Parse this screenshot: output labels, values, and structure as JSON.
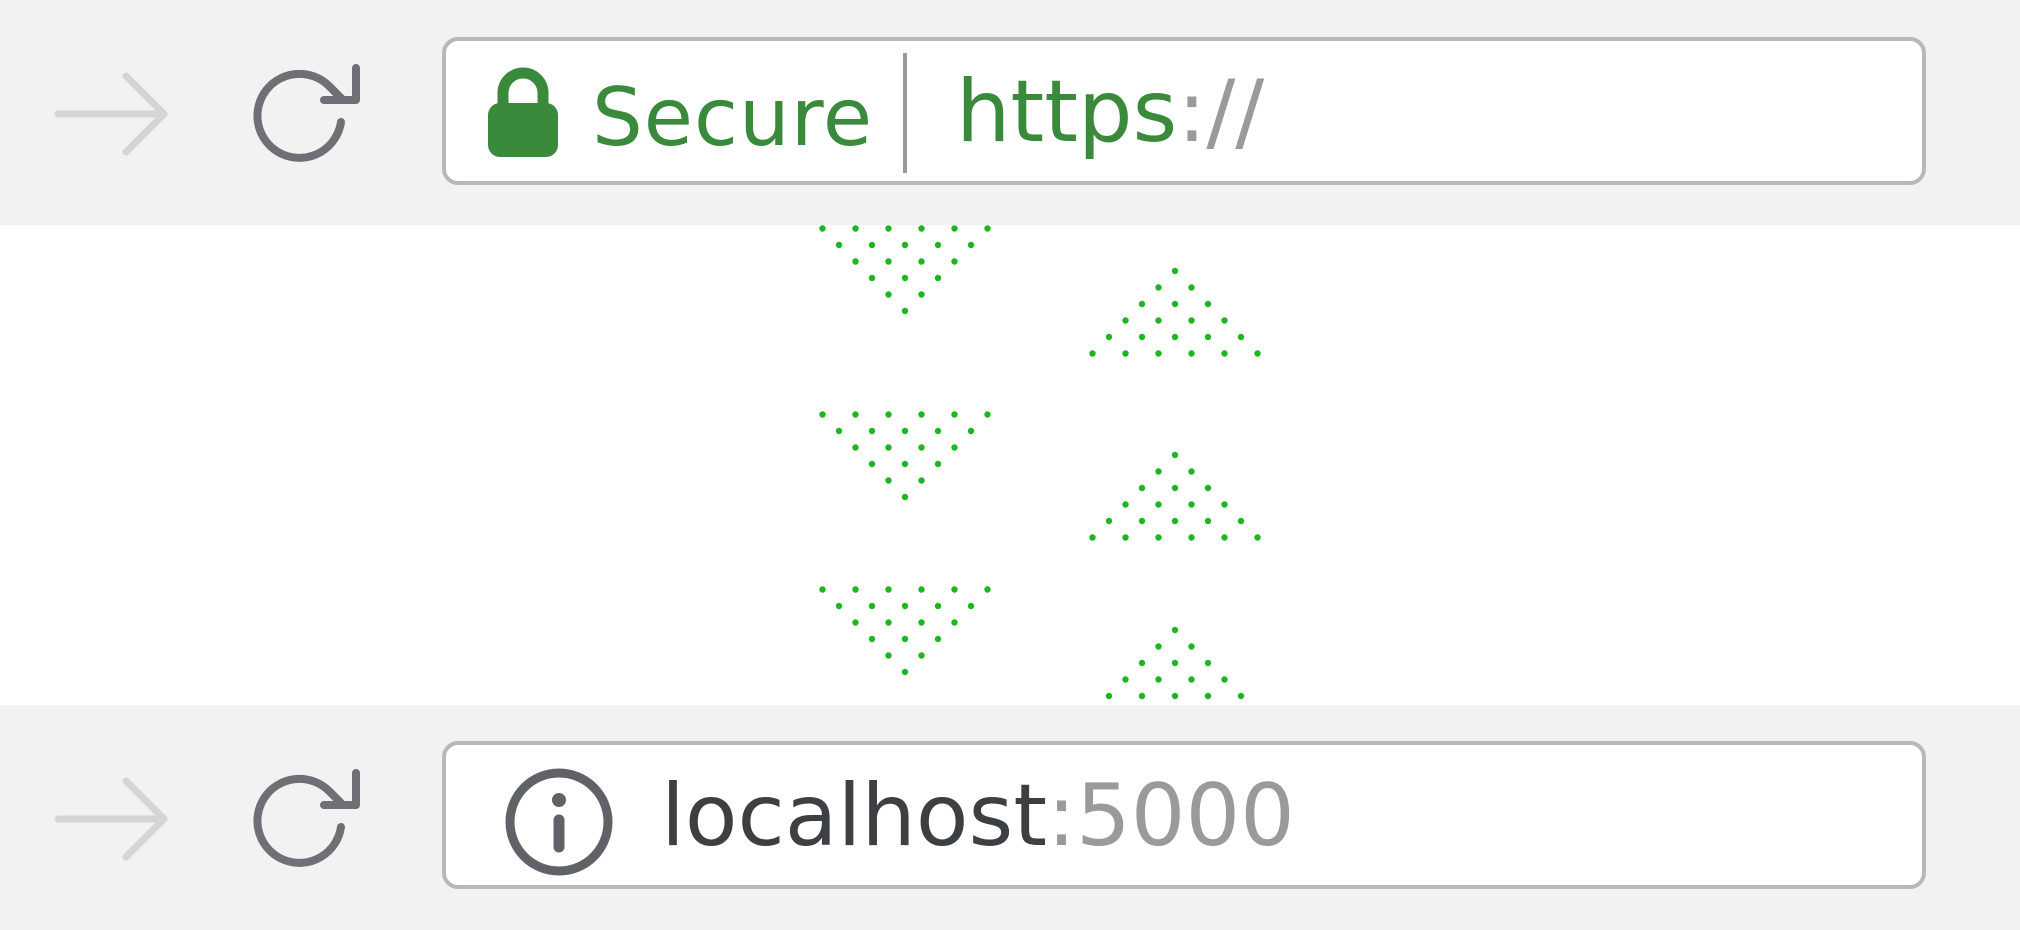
{
  "top_bar": {
    "forward_icon": "arrow-right-icon",
    "reload_icon": "reload-icon",
    "security_icon": "lock-icon",
    "security_label": "Secure",
    "url_scheme": "https",
    "url_separator": "://",
    "accent_color": "#3a8a3c"
  },
  "page_content": {
    "pattern": "dotted-chevrons",
    "pattern_color": "#1fb51f"
  },
  "bottom_bar": {
    "forward_icon": "arrow-right-icon",
    "reload_icon": "reload-icon",
    "info_icon": "info-icon",
    "host": "localhost",
    "port_separator": ":",
    "port": "5000"
  }
}
